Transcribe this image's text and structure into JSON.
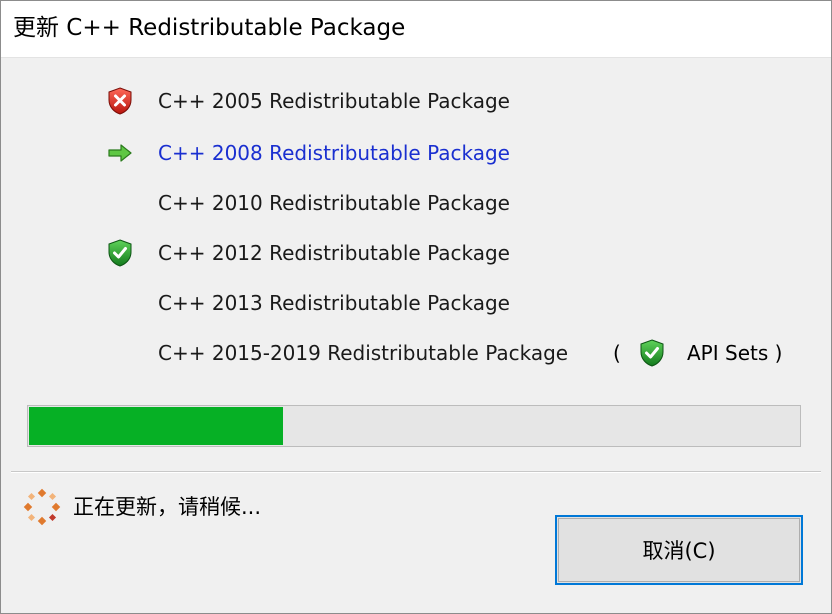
{
  "window": {
    "title": "更新 C++ Redistributable Package"
  },
  "packages": [
    {
      "label": "C++ 2005 Redistributable Package",
      "status": "error",
      "icon": "shield-error-icon"
    },
    {
      "label": "C++ 2008 Redistributable Package",
      "status": "current",
      "icon": "arrow-right-icon"
    },
    {
      "label": "C++ 2010 Redistributable Package",
      "status": "pending",
      "icon": ""
    },
    {
      "label": "C++ 2012 Redistributable Package",
      "status": "success",
      "icon": "shield-check-icon"
    },
    {
      "label": "C++ 2013 Redistributable Package",
      "status": "pending",
      "icon": ""
    },
    {
      "label": "C++ 2015-2019 Redistributable Package",
      "status": "pending",
      "icon": ""
    }
  ],
  "api_sets": {
    "open": "(",
    "label": "API Sets )",
    "icon": "shield-check-icon"
  },
  "progress": {
    "fraction": 0.33
  },
  "status": {
    "text": "正在更新，请稍候...",
    "icon": "spinner-icon"
  },
  "buttons": {
    "cancel_label": "取消(C)"
  },
  "colors": {
    "progress_fill": "#06b025",
    "current_text": "#1a2fd0",
    "button_focus_border": "#0078d7",
    "error_shield": "#d9261c",
    "success_shield": "#1f9a2e"
  }
}
